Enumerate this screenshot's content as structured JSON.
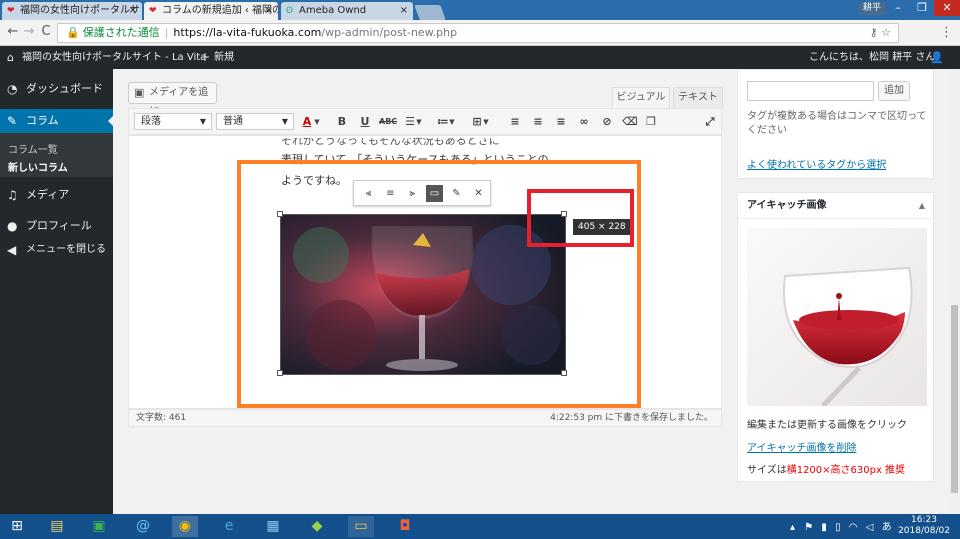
{
  "browser": {
    "tabs": [
      {
        "label": "福岡の女性向けポータルサ・",
        "active": false
      },
      {
        "label": "コラムの新規追加 ‹ 福岡の",
        "active": true
      },
      {
        "label": "Ameba Ownd",
        "active": false
      }
    ],
    "tab_close": "×",
    "user_chip": "耕平",
    "window_controls": {
      "minimize": "–",
      "restore": "❐",
      "close": "✕"
    },
    "nav": {
      "back": "←",
      "forward": "→",
      "reload": "C"
    },
    "address": {
      "secure_label": "保護された通信",
      "separator": "|",
      "url_host": "https://la-vita-fukuoka.com",
      "url_path": "/wp-admin/post-new.php"
    }
  },
  "admin_bar": {
    "site_name": "福岡の女性向けポータルサイト - La Vita",
    "new_label": "新規",
    "greeting": "こんにちは、松岡 耕平 さん"
  },
  "sidebar": {
    "items": [
      {
        "label": "ダッシュボード",
        "icon": "dashboard-icon"
      },
      {
        "label": "コラム",
        "icon": "pin-icon",
        "current": true
      },
      {
        "label": "メディア",
        "icon": "media-icon"
      },
      {
        "label": "プロフィール",
        "icon": "user-icon"
      },
      {
        "label": "メニューを閉じる",
        "icon": "collapse-icon"
      }
    ],
    "submenu": [
      {
        "label": "コラム一覧"
      },
      {
        "label": "新しいコラム",
        "current": true
      }
    ]
  },
  "editor": {
    "add_media_label": "メディアを追加",
    "tab_visual": "ビジュアル",
    "tab_text": "テキスト",
    "format_select": "段落",
    "font_select": "普通",
    "content_lines": [
      "表現していて、「そういうケースもある」ということの",
      "ようですね。"
    ],
    "image_size_tooltip": "405 × 228",
    "word_count": "文字数: 461",
    "autosave": "4:22:53 pm に下書きを保存しました。"
  },
  "tags_panel": {
    "add_button": "追加",
    "help_text": "タグが複数ある場合はコンマで区切ってください",
    "popular_link": "よく使われているタグから選択"
  },
  "featured_image_panel": {
    "title": "アイキャッチ画像",
    "help": "編集または更新する画像をクリック",
    "remove_link": "アイキャッチ画像を削除",
    "size_prefix": "サイズは",
    "size_red": "横1200×高さ630px 推奨"
  },
  "taskbar": {
    "time": "16:23",
    "date": "2018/08/02",
    "ime": "あ"
  },
  "colors": {
    "admin_dark": "#23282d",
    "wp_blue": "#0073aa",
    "annotation_orange": "#ff7f27",
    "annotation_red": "#e7202f"
  }
}
